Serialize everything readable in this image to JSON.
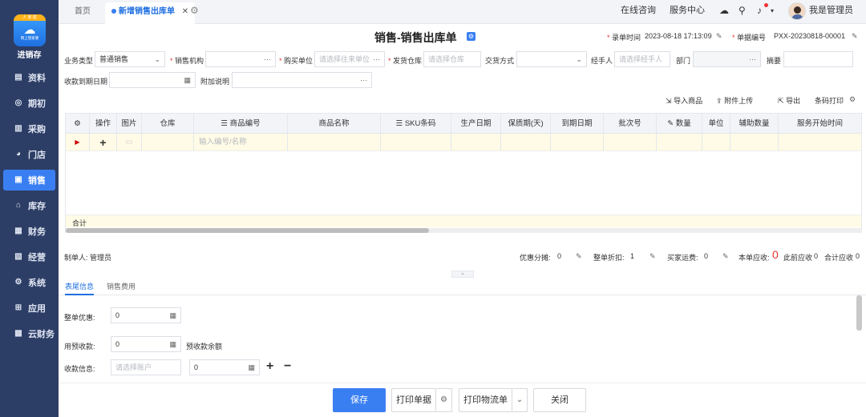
{
  "sidebar": {
    "logo_ribbon": "人 家 庭",
    "logo_tiny": "网上管家婆",
    "app_name": "进销存",
    "items": [
      {
        "label": "资料",
        "icon": "document-icon"
      },
      {
        "label": "期初",
        "icon": "target-icon"
      },
      {
        "label": "采购",
        "icon": "bar-chart-icon"
      },
      {
        "label": "门店",
        "icon": "pie-chart-icon"
      },
      {
        "label": "销售",
        "icon": "sales-chart-icon"
      },
      {
        "label": "库存",
        "icon": "home-icon"
      },
      {
        "label": "财务",
        "icon": "wallet-icon"
      },
      {
        "label": "经营",
        "icon": "ledger-icon"
      },
      {
        "label": "系统",
        "icon": "gear-icon"
      },
      {
        "label": "应用",
        "icon": "plus-square-icon"
      },
      {
        "label": "云财务",
        "icon": "cloud-finance-icon"
      }
    ],
    "active_index": 4
  },
  "topbar": {
    "tab_home": "首页",
    "tab_active": "新增销售出库单",
    "consult": "在线咨询",
    "service": "服务中心",
    "user": "我是管理员"
  },
  "form": {
    "title": "销售-销售出库单",
    "entry_time_label": "录单时间",
    "entry_time": "2023-08-18 17:13:09",
    "bill_no_label": "单据编号",
    "bill_no": "PXX-20230818-00001",
    "biz_type_label": "业务类型",
    "biz_type": "普通销售",
    "sales_org_label": "销售机构",
    "buyer_label": "购买单位",
    "buyer_ph": "请选择往来单位",
    "warehouse_label": "发货仓库",
    "warehouse_ph": "请选择仓库",
    "trade_label": "交货方式",
    "handler_label": "经手人",
    "handler_ph": "请选择经手人",
    "dept_label": "部门",
    "summary_label": "摘要",
    "due_label": "收款到期日期",
    "note_label": "附加说明"
  },
  "toolbar": {
    "import": "导入商品",
    "attach": "附件上传",
    "export": "导出",
    "barcode": "条码打印"
  },
  "grid": {
    "columns": [
      "操作",
      "图片",
      "仓库",
      "商品编号",
      "商品名称",
      "SKU条码",
      "生产日期",
      "保质期(天)",
      "到期日期",
      "批次号",
      "数量",
      "单位",
      "辅助数量",
      "服务开始时间"
    ],
    "row_placeholder": "输入编号/名称",
    "total_label": "合计"
  },
  "summary": {
    "maker": "制单人: 管理员",
    "discount_share_label": "优惠分摊:",
    "discount_share": "0",
    "whole_discount_label": "整单折扣:",
    "whole_discount": "1",
    "freight_label": "买家运费:",
    "freight": "0",
    "receivable_label": "本单应收:",
    "receivable": "0",
    "prev_label": "此前应收",
    "prev": "0",
    "total_label": "合计应收",
    "total": "0"
  },
  "bottom_tabs": [
    "表尾信息",
    "销售费用"
  ],
  "bottom_form": {
    "whole_discount_label": "整单优惠:",
    "whole_discount": "0",
    "prepay_label": "用预收款:",
    "prepay": "0",
    "prepay_balance": "预收款余额",
    "receipt_label": "收款信息:",
    "account_ph": "请选择账户",
    "receipt_amount": "0"
  },
  "buttons": {
    "save": "保存",
    "print": "打印单据",
    "print_logistics": "打印物流单",
    "close": "关闭"
  },
  "colors": {
    "sidebar": "#2d3e66",
    "accent": "#3a7ff2",
    "danger": "#e33333"
  }
}
